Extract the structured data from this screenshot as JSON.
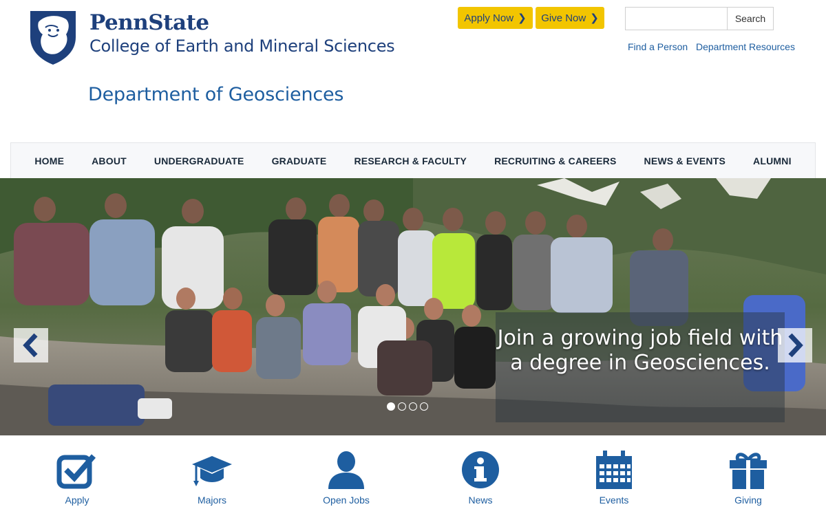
{
  "header": {
    "brand_name": "PennState",
    "brand_sub": "College of Earth and Mineral Sciences",
    "dept_title": "Department of Geosciences",
    "apply_label": "Apply Now",
    "give_label": "Give Now",
    "chevron": "❯",
    "search_button": "Search",
    "search_value": "",
    "util_links": [
      "Find a Person",
      "Department Resources"
    ]
  },
  "nav": {
    "items": [
      "HOME",
      "ABOUT",
      "UNDERGRADUATE",
      "GRADUATE",
      "RESEARCH & FACULTY",
      "RECRUITING & CAREERS",
      "NEWS & EVENTS",
      "ALUMNI"
    ]
  },
  "hero": {
    "caption": "Join a growing job field with a degree in Geosciences.",
    "slide_count": 4,
    "active_slide": 1
  },
  "quick_links": [
    {
      "label": "Apply",
      "icon": "checkbox-icon"
    },
    {
      "label": "Majors",
      "icon": "graduation-cap-icon"
    },
    {
      "label": "Open Jobs",
      "icon": "person-icon"
    },
    {
      "label": "News",
      "icon": "info-icon"
    },
    {
      "label": "Events",
      "icon": "calendar-icon"
    },
    {
      "label": "Giving",
      "icon": "gift-icon"
    }
  ],
  "colors": {
    "brand_navy": "#1e407c",
    "link_blue": "#1e5ea0",
    "cta_yellow": "#f2c500",
    "icon_blue": "#1e5ea0"
  }
}
